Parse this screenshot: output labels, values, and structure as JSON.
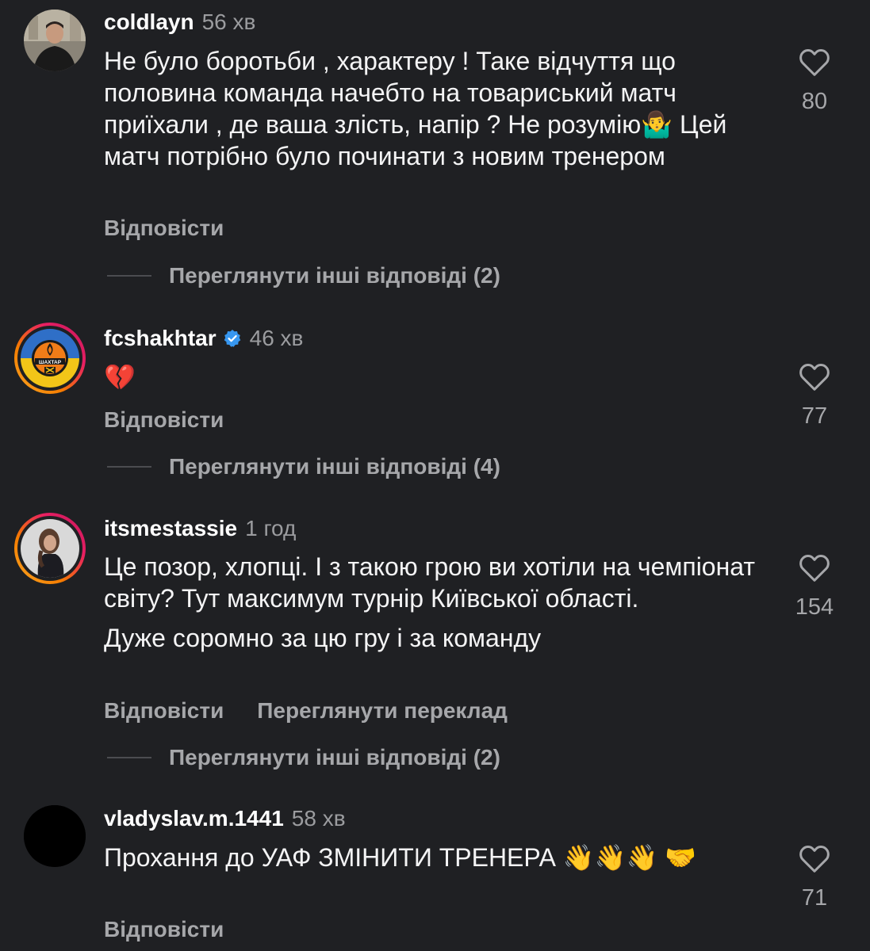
{
  "comments": [
    {
      "username": "coldlayn",
      "time": "56 хв",
      "text": "Не було боротьби , характеру ! Таке відчуття що половина команда начебто на товариський матч приїхали , де ваша злість, напір ? Не розумію🤷‍♂️ Цей матч потрібно було починати з новим тренером",
      "reply_label": "Відповісти",
      "likes": "80",
      "view_replies": "Переглянути інші відповіді (2)"
    },
    {
      "username": "fcshakhtar",
      "time": "46 хв",
      "text": "💔",
      "reply_label": "Відповісти",
      "likes": "77",
      "view_replies": "Переглянути інші відповіді (4)",
      "avatar_logo_text": "ШАХТАР"
    },
    {
      "username": "itsmestassie",
      "time": "1 год",
      "text": "Це позор, хлопці. І з такою грою ви хотіли на чемпіонат світу? Тут максимум турнір Київської області.",
      "text2": "Дуже соромно за цю гру і за команду",
      "reply_label": "Відповісти",
      "translate_label": "Переглянути переклад",
      "likes": "154",
      "view_replies": "Переглянути інші відповіді (2)"
    },
    {
      "username": "vladyslav.m.1441",
      "time": "58 хв",
      "text": "Прохання до УАФ ЗМІНИТИ ТРЕНЕРА 👋👋👋 🤝",
      "reply_label": "Відповісти",
      "likes": "71"
    }
  ],
  "colors": {
    "background": "#1f2023",
    "muted": "#a6a7aa",
    "verified": "#3797f0"
  },
  "icons": {
    "like": "heart-outline-icon",
    "verified": "verified-badge-icon"
  }
}
